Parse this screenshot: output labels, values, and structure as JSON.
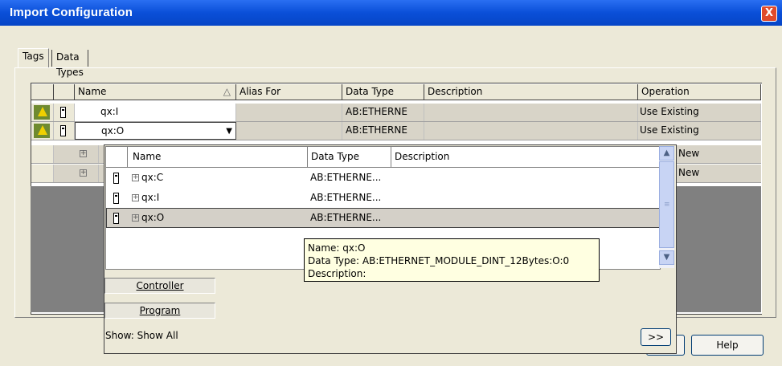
{
  "window": {
    "title": "Import Configuration",
    "close": "X"
  },
  "tabs": [
    {
      "label": "Tags"
    },
    {
      "label": "Data Types"
    }
  ],
  "grid": {
    "columns": {
      "name": "Name",
      "sort": "△",
      "alias": "Alias For",
      "data_type": "Data Type",
      "description": "Description",
      "operation": "Operation"
    },
    "rows": [
      {
        "name": "qx:I",
        "data_type": "AB:ETHERNE",
        "operation": "Use Existing"
      },
      {
        "name": "qx:O",
        "data_type": "AB:ETHERNE",
        "operation": "Use Existing"
      },
      {
        "expander": "+",
        "operation": "New"
      },
      {
        "expander": "+",
        "operation": "New"
      }
    ]
  },
  "popup": {
    "columns": {
      "name": "Name",
      "data_type": "Data Type",
      "description": "Description"
    },
    "items": [
      {
        "expander": "+",
        "name": "qx:C",
        "data_type": "AB:ETHERNE..."
      },
      {
        "expander": "+",
        "name": "qx:I",
        "data_type": "AB:ETHERNE..."
      },
      {
        "expander": "+",
        "name": "qx:O",
        "data_type": "AB:ETHERNE..."
      }
    ],
    "tooltip": {
      "line1": "Name: qx:O",
      "line2": "Data Type: AB:ETHERNET_MODULE_DINT_12Bytes:O:0",
      "line3": "Description:"
    },
    "filter_controller": "Controller",
    "filter_program": "Program",
    "show_label": "Show: Show All",
    "expand_button": ">>"
  },
  "buttons": {
    "help": "Help"
  },
  "scroll": {
    "up": "▲",
    "down": "▼",
    "grip": "≡"
  },
  "dropdown_arrow": "▼"
}
